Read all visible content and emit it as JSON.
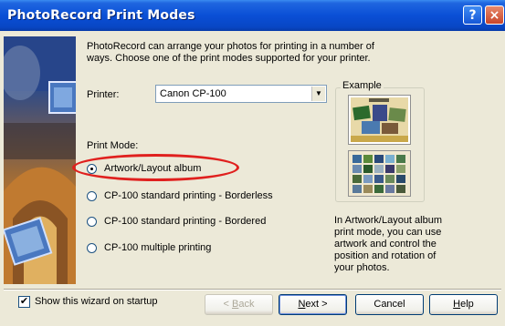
{
  "window": {
    "title": "PhotoRecord Print Modes",
    "help_button": "?",
    "close_button": "×"
  },
  "intro_text": "PhotoRecord can arrange your photos for printing in a number of ways. Choose one of the print modes supported for your printer.",
  "printer": {
    "label": "Printer:",
    "value": "Canon CP-100"
  },
  "print_mode": {
    "label": "Print Mode:",
    "options": [
      {
        "label": "Artwork/Layout album",
        "selected": true
      },
      {
        "label": "CP-100 standard printing - Borderless",
        "selected": false
      },
      {
        "label": "CP-100 standard printing - Bordered",
        "selected": false
      },
      {
        "label": "CP-100 multiple printing",
        "selected": false
      }
    ]
  },
  "example": {
    "title": "Example",
    "description": "In Artwork/Layout album print mode, you can use artwork and control the position and rotation of your photos."
  },
  "startup_checkbox": {
    "label": "Show this wizard on startup",
    "checked": true
  },
  "buttons": {
    "back": {
      "prefix": "< ",
      "mnemonic": "B",
      "rest": "ack"
    },
    "next": {
      "mnemonic": "N",
      "rest": "ext >"
    },
    "cancel": "Cancel",
    "help": {
      "mnemonic": "H",
      "rest": "elp"
    }
  },
  "colors": {
    "highlight_ring": "#e0201e",
    "titlebar": "#0a4fd6"
  }
}
